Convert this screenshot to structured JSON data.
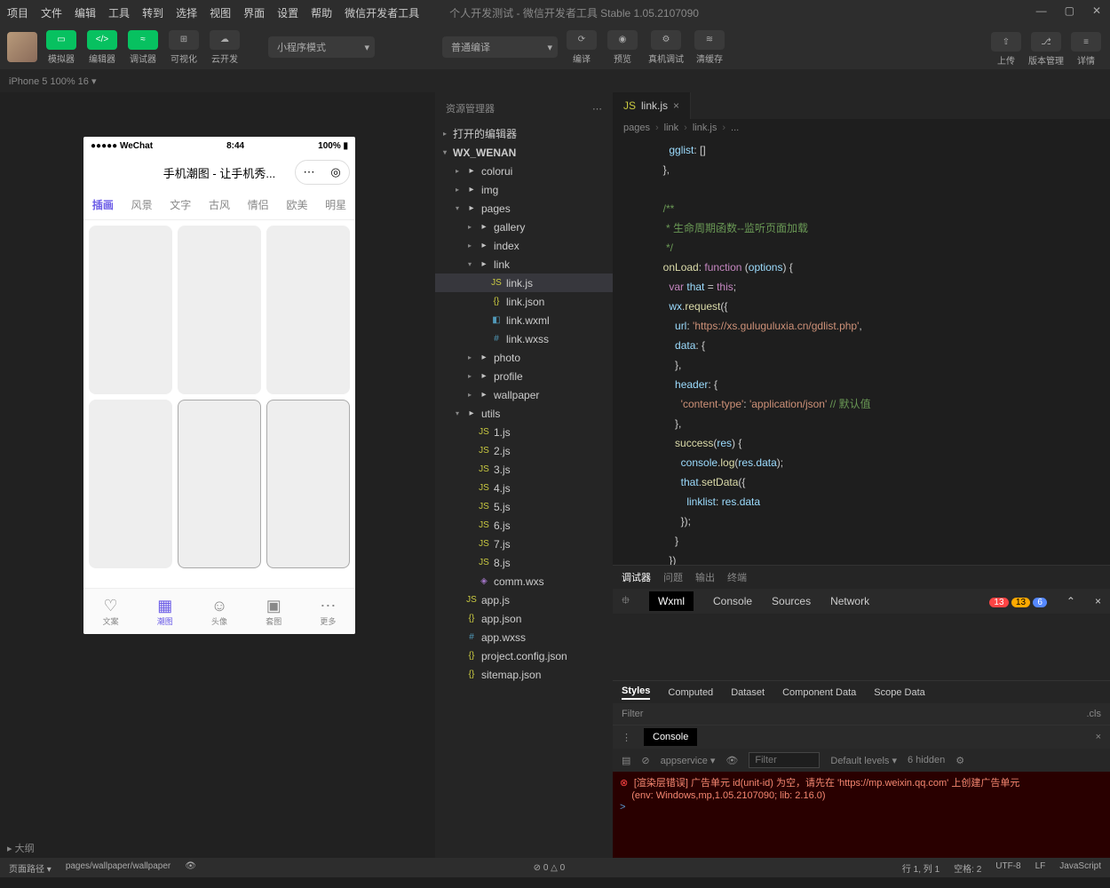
{
  "menu": [
    "项目",
    "文件",
    "编辑",
    "工具",
    "转到",
    "选择",
    "视图",
    "界面",
    "设置",
    "帮助",
    "微信开发者工具"
  ],
  "wintitle": "个人开发测试 - 微信开发者工具 Stable 1.05.2107090",
  "toolbar": {
    "groups": {
      "sim": "模拟器",
      "editor": "编辑器",
      "debugger": "调试器",
      "visual": "可视化",
      "cloud": "云开发"
    },
    "mode": "小程序模式",
    "compile": "普通编译",
    "actions": {
      "compile": "编译",
      "preview": "预览",
      "debug": "真机调试",
      "clear": "清缓存"
    },
    "right": {
      "upload": "上传",
      "version": "版本管理",
      "detail": "详情"
    }
  },
  "simbar": "iPhone 5 100% 16 ▾",
  "phone": {
    "carrier": "●●●●● WeChat",
    "time": "8:44",
    "batt": "100%",
    "title": "手机潮图 - 让手机秀...",
    "tabs": [
      "插画",
      "风景",
      "文字",
      "古风",
      "情侣",
      "欧美",
      "明星"
    ],
    "tabbar": [
      "文案",
      "潮图",
      "头像",
      "套图",
      "更多"
    ]
  },
  "explorer": {
    "title": "资源管理器",
    "open": "打开的编辑器",
    "proj": "WX_WENAN",
    "tree": [
      {
        "t": "folder",
        "n": "colorui",
        "d": 1
      },
      {
        "t": "folder",
        "n": "img",
        "d": 1
      },
      {
        "t": "folder",
        "n": "pages",
        "d": 1,
        "open": true
      },
      {
        "t": "folder",
        "n": "gallery",
        "d": 2
      },
      {
        "t": "folder",
        "n": "index",
        "d": 2
      },
      {
        "t": "folder",
        "n": "link",
        "d": 2,
        "open": true
      },
      {
        "t": "js",
        "n": "link.js",
        "d": 3,
        "sel": true
      },
      {
        "t": "json",
        "n": "link.json",
        "d": 3
      },
      {
        "t": "wxml",
        "n": "link.wxml",
        "d": 3
      },
      {
        "t": "wxss",
        "n": "link.wxss",
        "d": 3
      },
      {
        "t": "folder",
        "n": "photo",
        "d": 2
      },
      {
        "t": "folder",
        "n": "profile",
        "d": 2
      },
      {
        "t": "folder",
        "n": "wallpaper",
        "d": 2
      },
      {
        "t": "folder",
        "n": "utils",
        "d": 1,
        "open": true
      },
      {
        "t": "js",
        "n": "1.js",
        "d": 2
      },
      {
        "t": "js",
        "n": "2.js",
        "d": 2
      },
      {
        "t": "js",
        "n": "3.js",
        "d": 2
      },
      {
        "t": "js",
        "n": "4.js",
        "d": 2
      },
      {
        "t": "js",
        "n": "5.js",
        "d": 2
      },
      {
        "t": "js",
        "n": "6.js",
        "d": 2
      },
      {
        "t": "js",
        "n": "7.js",
        "d": 2
      },
      {
        "t": "js",
        "n": "8.js",
        "d": 2
      },
      {
        "t": "wxs",
        "n": "comm.wxs",
        "d": 2
      },
      {
        "t": "js",
        "n": "app.js",
        "d": 1
      },
      {
        "t": "json",
        "n": "app.json",
        "d": 1
      },
      {
        "t": "wxss",
        "n": "app.wxss",
        "d": 1
      },
      {
        "t": "json",
        "n": "project.config.json",
        "d": 1
      },
      {
        "t": "json",
        "n": "sitemap.json",
        "d": 1
      }
    ]
  },
  "editor": {
    "tab": "link.js",
    "crumb": [
      "pages",
      "link",
      "link.js",
      "..."
    ],
    "code": [
      {
        "i": 0,
        "h": "    <span class='p'>gglist</span>: []"
      },
      {
        "i": 0,
        "h": "  },"
      },
      {
        "i": 0,
        "h": ""
      },
      {
        "i": 0,
        "h": "  <span class='c'>/**</span>"
      },
      {
        "i": 0,
        "h": "<span class='c'>   * 生命周期函数--监听页面加载</span>"
      },
      {
        "i": 0,
        "h": "<span class='c'>   */</span>"
      },
      {
        "i": 0,
        "h": "  <span class='f'>onLoad</span>: <span class='k'>function</span> (<span class='p'>options</span>) {"
      },
      {
        "i": 0,
        "h": "    <span class='k'>var</span> <span class='p'>that</span> = <span class='k'>this</span>;"
      },
      {
        "i": 0,
        "h": "    <span class='p'>wx</span>.<span class='f'>request</span>({"
      },
      {
        "i": 0,
        "h": "      <span class='p'>url</span>: <span class='s'>'https://xs.guluguluxia.cn/gdlist.php'</span>,"
      },
      {
        "i": 0,
        "h": "      <span class='p'>data</span>: {"
      },
      {
        "i": 0,
        "h": "      },"
      },
      {
        "i": 0,
        "h": "      <span class='p'>header</span>: {"
      },
      {
        "i": 0,
        "h": "        <span class='s'>'content-type'</span>: <span class='s'>'application/json'</span> <span class='c'>// 默认值</span>"
      },
      {
        "i": 0,
        "h": "      },"
      },
      {
        "i": 0,
        "h": "      <span class='f'>success</span>(<span class='p'>res</span>) {"
      },
      {
        "i": 0,
        "h": "        <span class='p'>console</span>.<span class='f'>log</span>(<span class='p'>res</span>.<span class='p'>data</span>);"
      },
      {
        "i": 0,
        "h": "        <span class='p'>that</span>.<span class='f'>setData</span>({"
      },
      {
        "i": 0,
        "h": "          <span class='p'>linklist</span>: <span class='p'>res</span>.<span class='p'>data</span>"
      },
      {
        "i": 0,
        "h": "        });"
      },
      {
        "i": 0,
        "h": "      }"
      },
      {
        "i": 0,
        "h": "    })"
      }
    ]
  },
  "debugger": {
    "primary": [
      "调试器",
      "问题",
      "输出",
      "终端"
    ],
    "tabs": [
      "Wxml",
      "Console",
      "Sources",
      "Network"
    ],
    "badges": {
      "err": "13",
      "warn": "13",
      "info": "6"
    },
    "styles": [
      "Styles",
      "Computed",
      "Dataset",
      "Component Data",
      "Scope Data"
    ],
    "filter": "Filter",
    "cls": ".cls"
  },
  "console": {
    "title": "Console",
    "ctx": "appservice",
    "levels": "Default levels",
    "hidden": "6 hidden",
    "msg": "[渲染层错误] 广告单元 id(unit-id) 为空，请先在 'https://mp.weixin.qq.com' 上创建广告单元",
    "env": "(env: Windows,mp,1.05.2107090; lib: 2.16.0)"
  },
  "outline": "▸ 大纲",
  "status": {
    "left": [
      "页面路径 ▾",
      "pages/wallpaper/wallpaper"
    ],
    "mid": [
      "⊘ 0 △ 0"
    ],
    "right": [
      "行 1, 列 1",
      "空格: 2",
      "UTF-8",
      "LF",
      "JavaScript"
    ]
  }
}
